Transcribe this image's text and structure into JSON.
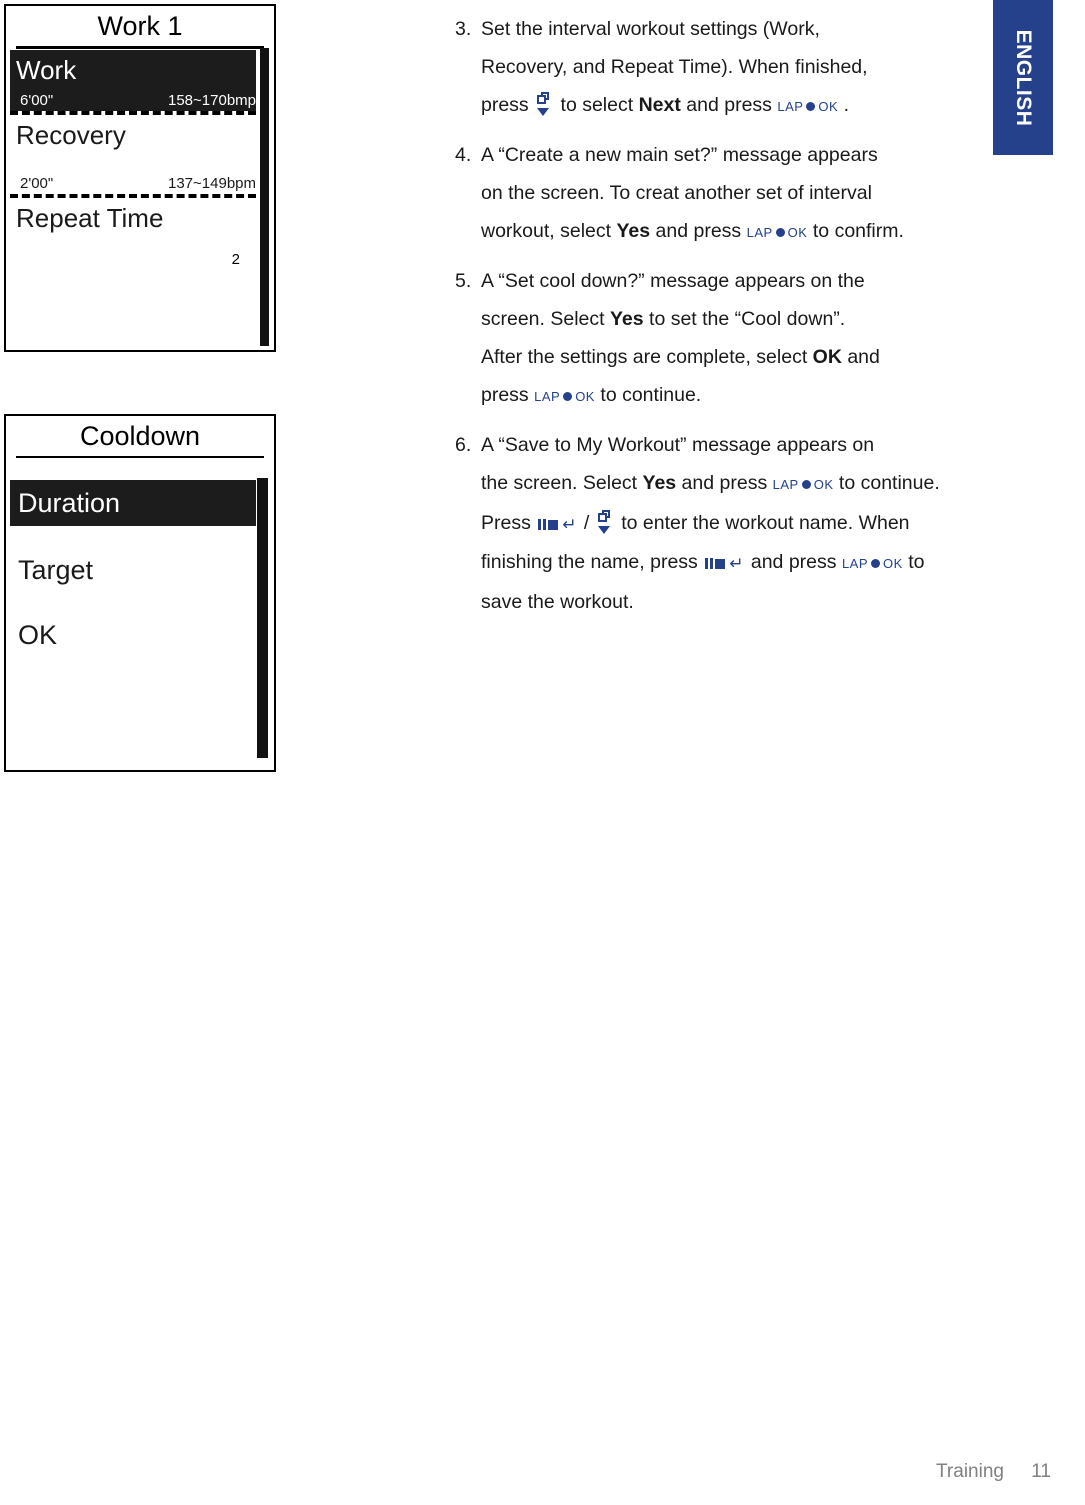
{
  "language_tab": {
    "label": "ENGLISH",
    "color": "#25418c"
  },
  "footer": {
    "section": "Training",
    "page": "11"
  },
  "device_screens": [
    {
      "name": "work-1-screen",
      "title": "Work 1",
      "rows": [
        {
          "label": "Work",
          "duration": "6'00\"",
          "heart_rate": "158~170bmp",
          "selected": true
        },
        {
          "label": "Recovery",
          "duration": "2'00\"",
          "heart_rate": "137~149bpm",
          "selected": false
        },
        {
          "label": "Repeat Time",
          "value": "2",
          "selected": false
        }
      ]
    },
    {
      "name": "cooldown-screen",
      "title": "Cooldown",
      "rows": [
        {
          "label": "Duration",
          "selected": true
        },
        {
          "label": "Target",
          "selected": false
        },
        {
          "label": "OK",
          "selected": false
        }
      ]
    }
  ],
  "icons": {
    "lap_ok": {
      "left": "LAP",
      "right": "OK",
      "name": "lap-ok-button-icon"
    },
    "page_down": {
      "name": "page-down-button-icon"
    },
    "pause_stop_back": {
      "name": "pause-stop-back-button-icon"
    }
  },
  "steps": [
    {
      "number": "3.",
      "lines": [
        [
          {
            "t": "text",
            "v": "Set the interval workout settings (Work,"
          }
        ],
        [
          {
            "t": "text",
            "v": "Recovery, and Repeat Time). When finished,"
          }
        ],
        [
          {
            "t": "text",
            "v": "press "
          },
          {
            "t": "icon",
            "v": "page_down"
          },
          {
            "t": "text",
            "v": " to select "
          },
          {
            "t": "bold",
            "v": "Next"
          },
          {
            "t": "text",
            "v": " and press "
          },
          {
            "t": "icon",
            "v": "lap_ok"
          },
          {
            "t": "text",
            "v": " ."
          }
        ]
      ]
    },
    {
      "number": "4.",
      "lines": [
        [
          {
            "t": "text",
            "v": "A “Create a new main set?” message appears"
          }
        ],
        [
          {
            "t": "text",
            "v": "on the screen. To creat another set of interval"
          }
        ],
        [
          {
            "t": "text",
            "v": "workout, select "
          },
          {
            "t": "bold",
            "v": "Yes"
          },
          {
            "t": "text",
            "v": " and press "
          },
          {
            "t": "icon",
            "v": "lap_ok"
          },
          {
            "t": "text",
            "v": " to confirm."
          }
        ]
      ]
    },
    {
      "number": "5.",
      "lines": [
        [
          {
            "t": "text",
            "v": "A “Set cool down?” message appears on the"
          }
        ],
        [
          {
            "t": "text",
            "v": "screen. Select "
          },
          {
            "t": "bold",
            "v": "Yes"
          },
          {
            "t": "text",
            "v": " to set the “Cool down”."
          }
        ],
        [
          {
            "t": "text",
            "v": "After the settings are complete, select "
          },
          {
            "t": "bold",
            "v": "OK"
          },
          {
            "t": "text",
            "v": " and"
          }
        ],
        [
          {
            "t": "text",
            "v": "press "
          },
          {
            "t": "icon",
            "v": "lap_ok"
          },
          {
            "t": "text",
            "v": " to continue."
          }
        ]
      ]
    },
    {
      "number": "6.",
      "lines": [
        [
          {
            "t": "text",
            "v": "A “Save to My Workout” message appears on"
          }
        ],
        [
          {
            "t": "text",
            "v": "the screen. Select "
          },
          {
            "t": "bold",
            "v": "Yes"
          },
          {
            "t": "text",
            "v": " and press "
          },
          {
            "t": "icon",
            "v": "lap_ok"
          },
          {
            "t": "text",
            "v": " to continue."
          }
        ],
        [
          {
            "t": "text",
            "v": "Press "
          },
          {
            "t": "icon",
            "v": "pause_stop_back"
          },
          {
            "t": "text",
            "v": " / "
          },
          {
            "t": "icon",
            "v": "page_down"
          },
          {
            "t": "text",
            "v": " to enter the workout name. When"
          }
        ],
        [
          {
            "t": "text",
            "v": "finishing the name, press "
          },
          {
            "t": "icon",
            "v": "pause_stop_back"
          },
          {
            "t": "text",
            "v": " and press "
          },
          {
            "t": "icon",
            "v": "lap_ok"
          },
          {
            "t": "text",
            "v": " to"
          }
        ],
        [
          {
            "t": "text",
            "v": "save the workout."
          }
        ]
      ]
    }
  ]
}
